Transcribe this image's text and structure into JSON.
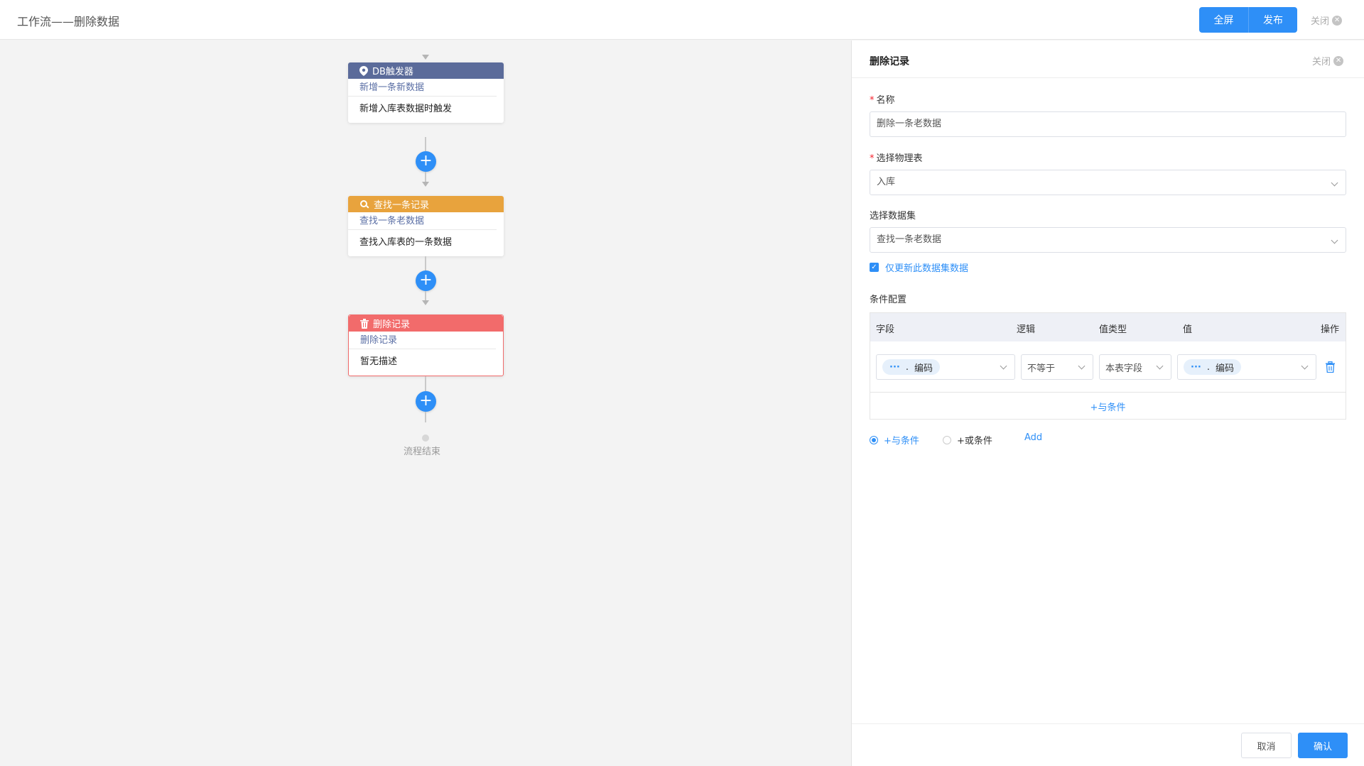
{
  "topbar": {
    "title": "工作流——删除数据",
    "fullscreen_label": "全屏",
    "publish_label": "发布",
    "close_label": "关闭"
  },
  "flow": {
    "nodes": [
      {
        "header": "DB触发器",
        "sub": "新增一条新数据",
        "desc": "新增入库表数据时触发",
        "color": "#5b6b9a",
        "icon": "location-pin-icon"
      },
      {
        "header": "查找一条记录",
        "sub": "查找一条老数据",
        "desc": "查找入库表的一条数据",
        "color": "#e8a33d",
        "icon": "search-icon"
      },
      {
        "header": "删除记录",
        "sub": "删除记录",
        "desc": "暂无描述",
        "color": "#f26b6b",
        "icon": "trash-icon"
      }
    ],
    "end_label": "流程结束"
  },
  "panel": {
    "title": "删除记录",
    "close_label": "关闭",
    "name_label": "名称",
    "name_value": "删除一条老数据",
    "table_label": "选择物理表",
    "table_value": "入库",
    "dataset_label": "选择数据集",
    "dataset_value": "查找一条老数据",
    "only_update_label": "仅更新此数据集数据",
    "condition_label": "条件配置",
    "columns": {
      "field": "字段",
      "logic": "逻辑",
      "value_type": "值类型",
      "value": "值",
      "op": "操作"
    },
    "row": {
      "field_dots": "···",
      "field_sep": ".",
      "field_value": "编码",
      "logic": "不等于",
      "value_type": "本表字段",
      "value_dots": "···",
      "value_sep": ".",
      "value_value": "编码"
    },
    "add_and_inline": "+与条件",
    "radio_and": "+与条件",
    "radio_or": "+或条件",
    "add_label": "Add",
    "cancel_label": "取消",
    "confirm_label": "确认"
  }
}
